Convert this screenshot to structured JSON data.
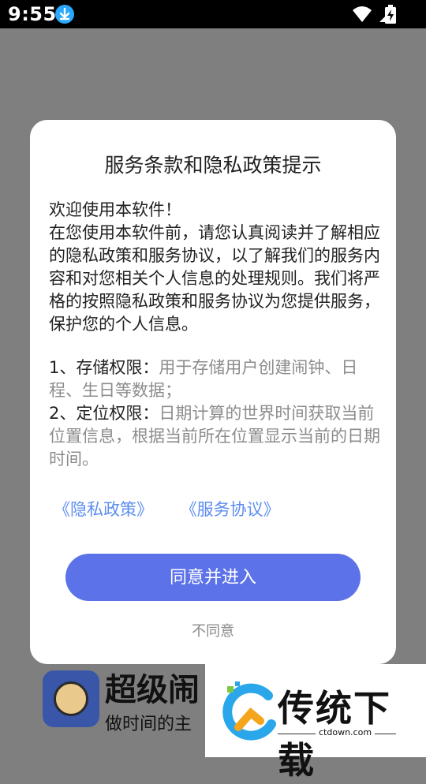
{
  "status_bar": {
    "time": "9:55"
  },
  "dialog": {
    "title": "服务条款和隐私政策提示",
    "body": {
      "intro_1": "欢迎使用本软件！",
      "intro_2": "在您使用本软件前，请您认真阅读并了解相应的隐私政策和服务协议，以了解我们的服务内容和对您相关个人信息的处理规则。我们将严格的按照隐私政策和服务协议为您提供服务，保护您的个人信息。"
    },
    "permissions": [
      {
        "label": "1、存储权限：",
        "desc": "用于存储用户创建闹钟、日程、生日等数据；"
      },
      {
        "label": " 2、定位权限：",
        "desc": "日期计算的世界时间获取当前位置信息，根据当前所在位置显示当前的日期时间。"
      }
    ],
    "links": {
      "privacy": "《隐私政策》",
      "service": "《服务协议》"
    },
    "agree_button": "同意并进入",
    "disagree_button": "不同意"
  },
  "background_app": {
    "name": "超级闹",
    "slogan": "做时间的主"
  },
  "watermark": {
    "text": "传统下载",
    "url": "ctdown.com"
  },
  "colors": {
    "accent": "#5b72e8",
    "link": "#5d8ef0",
    "overlay": "#7f7f7f"
  }
}
